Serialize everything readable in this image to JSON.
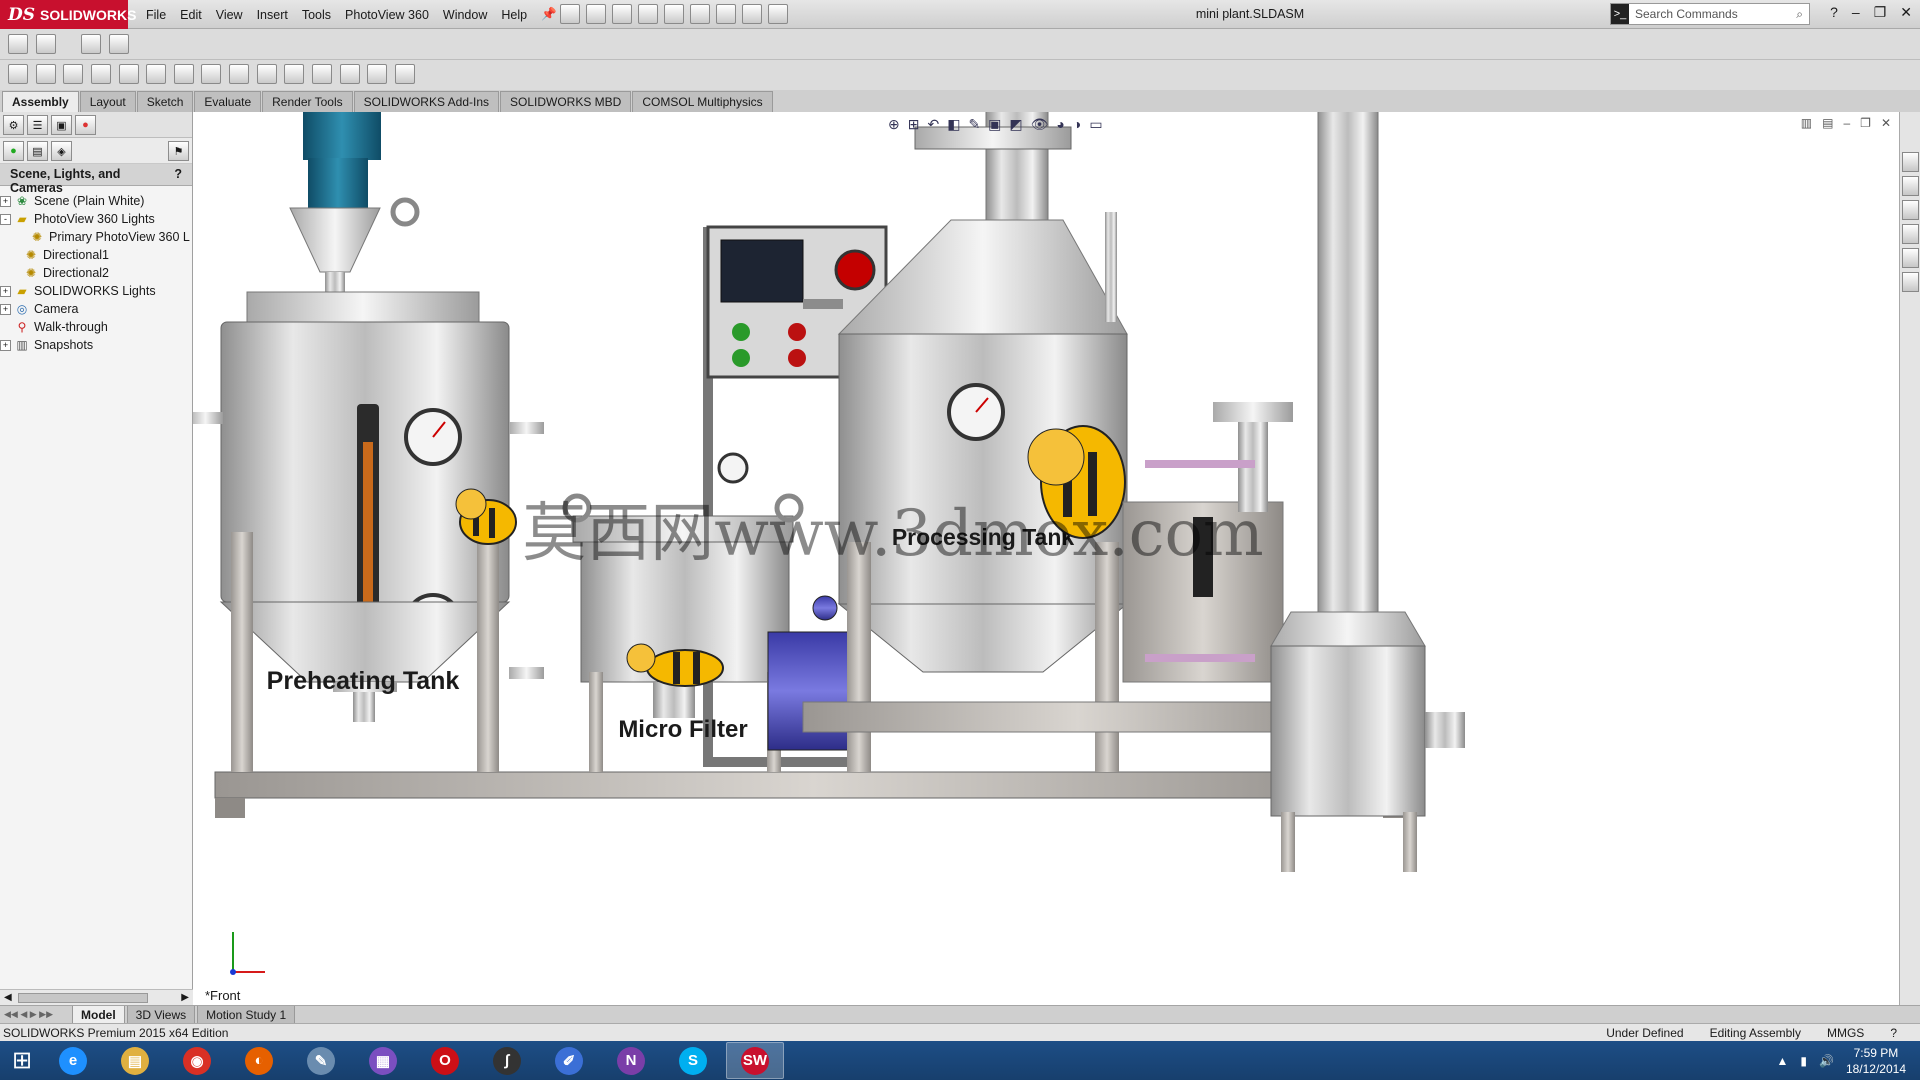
{
  "app": {
    "logo_text": "SOLIDWORKS",
    "window_title": "mini plant.SLDASM"
  },
  "menu": [
    "File",
    "Edit",
    "View",
    "Insert",
    "Tools",
    "PhotoView 360",
    "Window",
    "Help"
  ],
  "search": {
    "placeholder": "Search Commands"
  },
  "command_tabs": [
    {
      "label": "Assembly",
      "active": true
    },
    {
      "label": "Layout"
    },
    {
      "label": "Sketch"
    },
    {
      "label": "Evaluate"
    },
    {
      "label": "Render Tools"
    },
    {
      "label": "SOLIDWORKS Add-Ins"
    },
    {
      "label": "SOLIDWORKS MBD"
    },
    {
      "label": "COMSOL Multiphysics"
    }
  ],
  "sidebar": {
    "panel_title": "Scene, Lights, and Cameras",
    "help_glyph": "?",
    "tree": [
      {
        "label": "Scene (Plain White)",
        "expander": "+",
        "icon": "scene-icon"
      },
      {
        "label": "PhotoView 360 Lights",
        "expander": "-",
        "icon": "folder-icon"
      },
      {
        "label": "Primary PhotoView 360 L",
        "expander": "",
        "icon": "light-icon"
      },
      {
        "label": "Directional1",
        "expander": "",
        "icon": "light-icon"
      },
      {
        "label": "Directional2",
        "expander": "",
        "icon": "light-icon"
      },
      {
        "label": "SOLIDWORKS Lights",
        "expander": "+",
        "icon": "folder-icon"
      },
      {
        "label": "Camera",
        "expander": "+",
        "icon": "camera-icon"
      },
      {
        "label": "Walk-through",
        "expander": "",
        "icon": "walk-icon"
      },
      {
        "label": "Snapshots",
        "expander": "+",
        "icon": "snapshot-icon"
      }
    ]
  },
  "viewport": {
    "view_label": "*Front",
    "tank_labels": {
      "preheating": "Preheating Tank",
      "micro_filter": "Micro Filter",
      "processing": "Processing Tank"
    },
    "watermark": "莫西网www.3dmox.com"
  },
  "bottom_tabs": [
    {
      "label": "Model",
      "active": true
    },
    {
      "label": "3D Views"
    },
    {
      "label": "Motion Study 1"
    }
  ],
  "status": {
    "edition": "SOLIDWORKS Premium 2015 x64 Edition",
    "definition": "Under Defined",
    "mode": "Editing Assembly",
    "units": "MMGS"
  },
  "taskbar": {
    "time": "7:59 PM",
    "date": "18/12/2014",
    "apps": [
      {
        "name": "internet-explorer",
        "glyph": "e",
        "color": "#1e90ff"
      },
      {
        "name": "file-explorer",
        "glyph": "▤",
        "color": "#e0b040"
      },
      {
        "name": "chrome",
        "glyph": "◉",
        "color": "#d93025"
      },
      {
        "name": "firefox",
        "glyph": "◐",
        "color": "#e66000"
      },
      {
        "name": "paint",
        "glyph": "✎",
        "color": "#6a8caf"
      },
      {
        "name": "calculator",
        "glyph": "▦",
        "color": "#7b4fc0"
      },
      {
        "name": "opera",
        "glyph": "O",
        "color": "#cc0f16"
      },
      {
        "name": "curve-app",
        "glyph": "∫",
        "color": "#333333"
      },
      {
        "name": "paint-tool",
        "glyph": "✐",
        "color": "#3b6fd6"
      },
      {
        "name": "onenote",
        "glyph": "N",
        "color": "#7a3ea8"
      },
      {
        "name": "skype",
        "glyph": "S",
        "color": "#00aff0"
      },
      {
        "name": "solidworks-2015",
        "glyph": "SW",
        "color": "#c8102e",
        "active": true
      }
    ]
  },
  "colors": {
    "brand": "#c8102e",
    "taskbar": "#1d4e86",
    "steel": "#b9b9b9",
    "motor_blue": "#1f6f8f",
    "pump_blue": "#4b4bb8"
  }
}
